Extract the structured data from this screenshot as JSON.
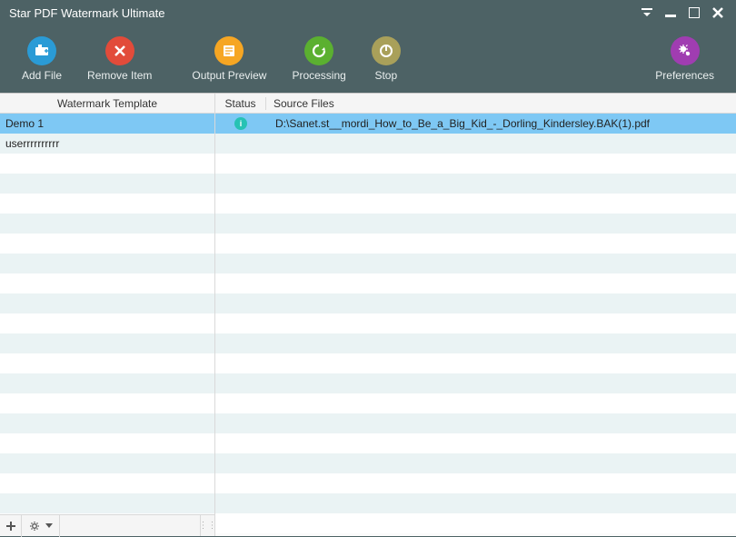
{
  "window": {
    "title": "Star PDF Watermark Ultimate"
  },
  "toolbar": {
    "add_file": "Add File",
    "remove_item": "Remove Item",
    "output_preview": "Output Preview",
    "processing": "Processing",
    "stop": "Stop",
    "preferences": "Preferences"
  },
  "left": {
    "header": "Watermark Template",
    "items": [
      {
        "label": "Demo 1",
        "selected": true
      },
      {
        "label": "userrrrrrrrrr",
        "selected": false
      }
    ]
  },
  "right": {
    "headers": {
      "status": "Status",
      "source": "Source Files"
    },
    "items": [
      {
        "status_icon": "info-icon",
        "source": "D:\\Sanet.st__mordi_How_to_Be_a_Big_Kid_-_Dorling_Kindersley.BAK(1).pdf",
        "selected": true
      }
    ]
  },
  "colors": {
    "add_file": "#2a9bd6",
    "remove_item": "#e24b3a",
    "output_preview": "#f6a623",
    "processing": "#5bb030",
    "stop": "#a9a05a",
    "preferences": "#a03db1"
  }
}
